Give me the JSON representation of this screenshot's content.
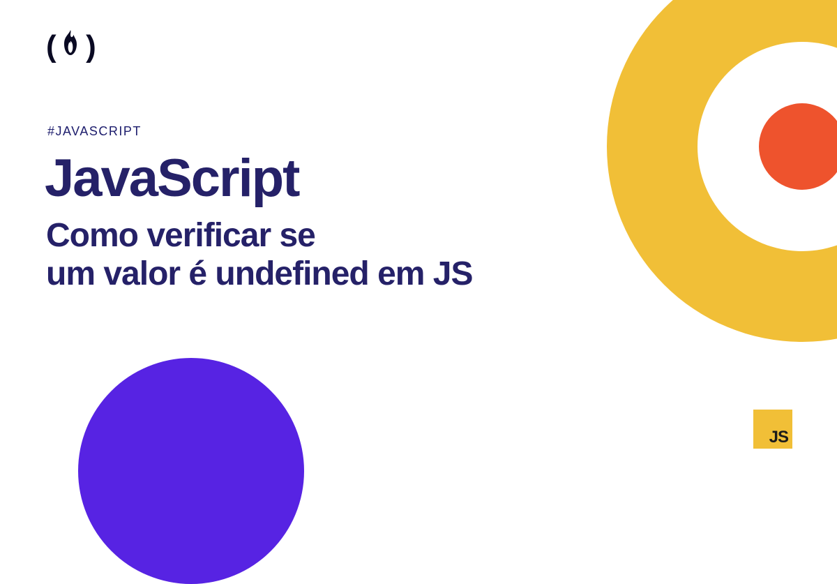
{
  "logo": {
    "left_paren": "(",
    "flame_glyph": "🔥",
    "right_paren": ")"
  },
  "hashtag": "#JAVASCRIPT",
  "title": "JavaScript",
  "subtitle_line1": "Como verificar se",
  "subtitle_line2": "um valor é undefined em JS",
  "js_badge": "JS",
  "colors": {
    "primary_text": "#252168",
    "hashtag_text": "#1c1c6c",
    "yellow": "#f1bf37",
    "orange": "#ee532d",
    "purple": "#5723e3",
    "js_bg": "#f1bf37",
    "js_text": "#1b1b1b"
  }
}
